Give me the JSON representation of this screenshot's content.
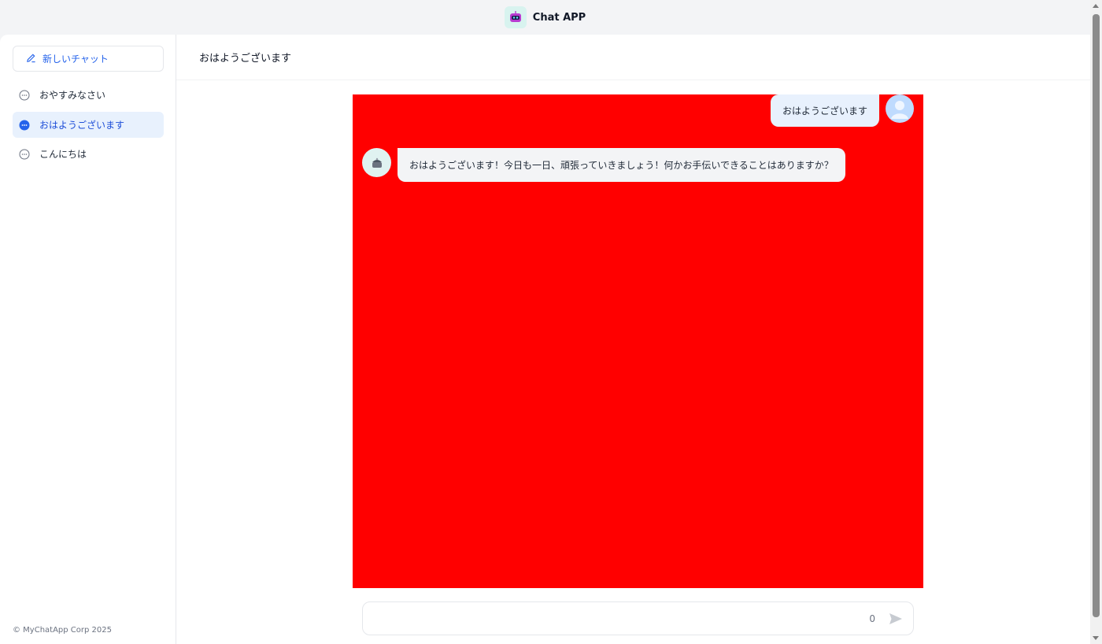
{
  "app": {
    "title": "Chat APP",
    "logo_icon": "robot-icon"
  },
  "sidebar": {
    "new_chat_label": "新しいチャット",
    "conversations": [
      {
        "label": "おやすみなさい",
        "active": false
      },
      {
        "label": "おはようございます",
        "active": true
      },
      {
        "label": "こんにちは",
        "active": false
      }
    ],
    "footer": "© MyChatApp Corp 2025"
  },
  "chat": {
    "title": "おはようございます",
    "messages": [
      {
        "role": "user",
        "text": "おはようございます"
      },
      {
        "role": "assistant",
        "text": "おはようございます！今日も一日、頑張っていきましょう！何かお手伝いできることはありますか？"
      }
    ]
  },
  "input": {
    "value": "",
    "char_count": "0"
  },
  "colors": {
    "accent": "#2563eb",
    "chat_background": "#ff0000",
    "active_item_bg": "#e8f1fd"
  }
}
